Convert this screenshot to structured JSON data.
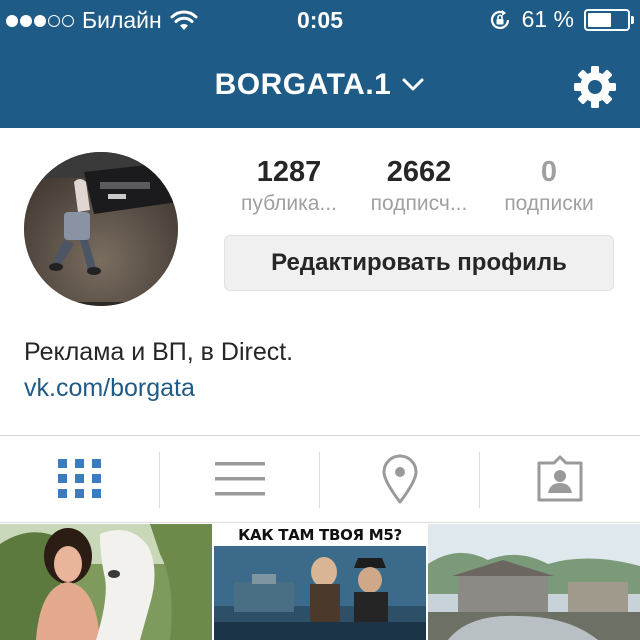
{
  "status_bar": {
    "carrier": "Билайн",
    "time": "0:05",
    "battery_percent": "61 %",
    "battery_level": 0.61,
    "signal_bars_filled": 3,
    "signal_bars_total": 5
  },
  "nav": {
    "username": "BORGATA.1"
  },
  "stats": [
    {
      "value": "1287",
      "label": "публика..."
    },
    {
      "value": "2662",
      "label": "подписч..."
    },
    {
      "value": "0",
      "label": "подписки"
    }
  ],
  "profile": {
    "edit_button": "Редактировать профиль",
    "bio": "Реклама и ВП, в Direct.",
    "link": "vk.com/borgata"
  },
  "tabs": [
    {
      "name": "grid-view",
      "icon": "grid-icon",
      "active": true
    },
    {
      "name": "list-view",
      "icon": "list-icon",
      "active": false
    },
    {
      "name": "map-view",
      "icon": "location-pin-icon",
      "active": false
    },
    {
      "name": "tagged-view",
      "icon": "tagged-person-icon",
      "active": false
    }
  ],
  "posts": [
    {
      "caption": ""
    },
    {
      "caption": "КАК ТАМ ТВОЯ М5?"
    },
    {
      "caption": ""
    }
  ],
  "colors": {
    "header": "#1f5b87",
    "accent": "#3b7bbf",
    "link": "#1f5b87",
    "muted": "#a0a0a0"
  }
}
